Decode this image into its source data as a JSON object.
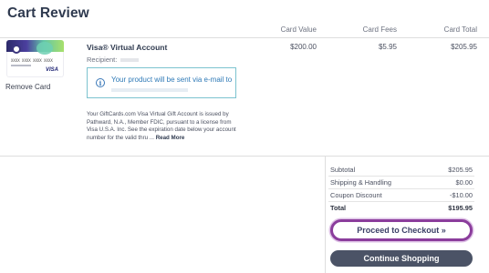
{
  "page": {
    "title": "Cart Review"
  },
  "columns": {
    "card_value": "Card Value",
    "card_fees": "Card Fees",
    "card_total": "Card Total"
  },
  "item": {
    "card_number_text": "XXXX XXXX XXXX XXXX",
    "card_brand": "VISA",
    "remove_label": "Remove Card",
    "product_name": "Visa® Virtual Account",
    "recipient_label": "Recipient:",
    "info_text": "Your product will be sent via e-mail to",
    "disclaimer": "Your GiftCards.com Visa Virtual Gift Account is issued by Pathward, N.A., Member FDIC, pursuant to a license from Visa U.S.A. Inc. See the expiration date below your account number for the valid thru ...",
    "read_more": "Read More",
    "card_value": "$200.00",
    "card_fees": "$5.95",
    "card_total": "$205.95"
  },
  "summary": {
    "subtotal_label": "Subtotal",
    "subtotal_value": "$205.95",
    "shipping_label": "Shipping & Handling",
    "shipping_value": "$0.00",
    "coupon_label": "Coupon Discount",
    "coupon_value": "-$10.00",
    "total_label": "Total",
    "total_value": "$195.95"
  },
  "buttons": {
    "checkout": "Proceed to Checkout »",
    "continue": "Continue Shopping"
  },
  "colors": {
    "accent_purple": "#8b3d9c",
    "info_border": "#7cc3cf",
    "info_text": "#2f7ab7",
    "continue_bg": "#4b5366"
  }
}
